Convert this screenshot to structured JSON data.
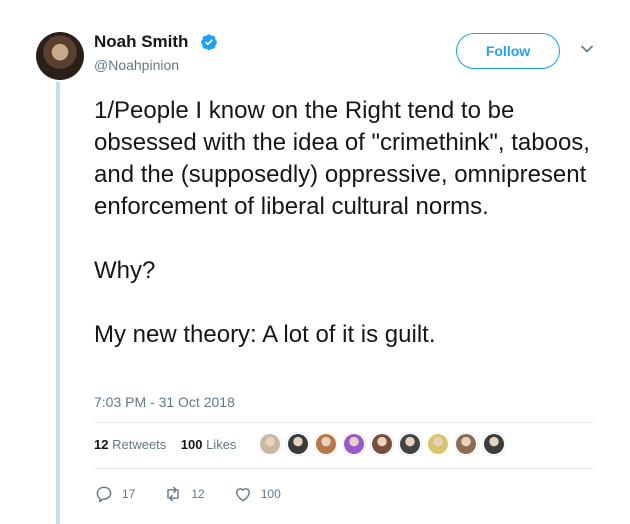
{
  "author": {
    "name": "Noah Smith",
    "handle": "@Noahpinion",
    "verified": true,
    "avatar_icon": "avatar-icon"
  },
  "follow_button": {
    "label": "Follow"
  },
  "tweet": {
    "text": "1/People I know on the Right tend to be obsessed with the idea of \"crimethink\", taboos, and the (supposedly) oppressive, omnipresent enforcement of liberal cultural norms.\n\nWhy?\n\nMy new theory: A lot of it is guilt.",
    "timestamp": "7:03 PM - 31 Oct 2018"
  },
  "stats": {
    "retweets_count": "12",
    "retweets_label": "Retweets",
    "likes_count": "100",
    "likes_label": "Likes"
  },
  "liker_avatars": [
    "#c7b9a6",
    "#3a3a3a",
    "#b7774a",
    "#9b59d0",
    "#7a4d3c",
    "#444444",
    "#d8c46a",
    "#8a6d57",
    "#3c3c3c"
  ],
  "actions": {
    "reply_count": "17",
    "retweet_count": "12",
    "like_count": "100"
  },
  "colors": {
    "accent": "#1da1f2",
    "thread_line": "#c4dff3",
    "muted_text": "#657786"
  }
}
